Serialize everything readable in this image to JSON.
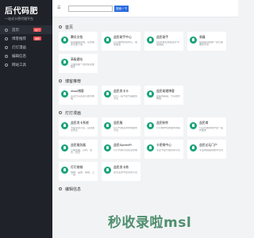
{
  "logo": {
    "main": "后代码肥",
    "sub": "一站式卡密代理平台"
  },
  "sidebar": {
    "items": [
      {
        "label": "首页",
        "badge": "热门",
        "active": true
      },
      {
        "label": "博客推荐",
        "badge": "推荐"
      },
      {
        "label": "灯灯漫画",
        "badge": ""
      },
      {
        "label": "编辑信息",
        "badge": ""
      },
      {
        "label": "网站工具",
        "badge": ""
      }
    ]
  },
  "topbar": {
    "search_placeholder": "",
    "search_button": "搜索一下"
  },
  "sections": [
    {
      "title": "首页",
      "cards": [
        {
          "title": "腾讯文档",
          "desc": "在线编辑文档，实时保存无需下载"
        },
        {
          "title": "益民助手中心",
          "desc": "灯灯发布秒赞中心，刷赞保活"
        },
        {
          "title": "益民助手",
          "desc": "QQ代刷全网最低价卡密网站"
        },
        {
          "title": "易媒",
          "desc": "短视频自媒体一键分发服务平台"
        },
        {
          "title": "高级建站",
          "desc": "云服务器一键安装全能程序"
        }
      ]
    },
    {
      "title": "博客推荐",
      "cards": [
        {
          "title": "xbox博客",
          "desc": "专注分享资源与技术教程"
        },
        {
          "title": "益民发卡卡",
          "desc": "灯灯—站卡密代理服务平台"
        },
        {
          "title": "益民助理博客",
          "desc": "益民博客站，分享技术教程"
        }
      ]
    },
    {
      "title": "灯灯漫画",
      "cards": [
        {
          "title": "益民发卡系统",
          "desc": "卡密交易平台，自动发货安全"
        },
        {
          "title": "益民服",
          "desc": "灯灯代刷业务秒刷服务平台"
        },
        {
          "title": "益民制作",
          "desc": "灯灯制作优质服务网站"
        },
        {
          "title": "益民商",
          "desc": "灯灯代刷商城卡密一站式服务"
        },
        {
          "title": "益民服务器",
          "desc": "云服务器，高防，低价，稳定"
        },
        {
          "title": "益民SpeedPi",
          "desc": "灯灯代刷平台稳定秒刷"
        },
        {
          "title": "卡密商中心",
          "desc": "专业卡密代理交易平台"
        },
        {
          "title": "益民论坛门户",
          "desc": "专业网站提供技术交流"
        },
        {
          "title": "灯灯商城",
          "desc": "购物，品质，保障，上一站"
        },
        {
          "title": "益民发卡商",
          "desc": "最专业的卡密交易平台"
        }
      ]
    },
    {
      "title": "编辑信息",
      "cards": []
    }
  ],
  "watermark": "秒收录啦msl",
  "colors": {
    "sidebar_bg": "#1f2329",
    "accent": "#2b6de0",
    "icon_green": "#1aa37a",
    "badge_red": "#ff4d4f"
  }
}
